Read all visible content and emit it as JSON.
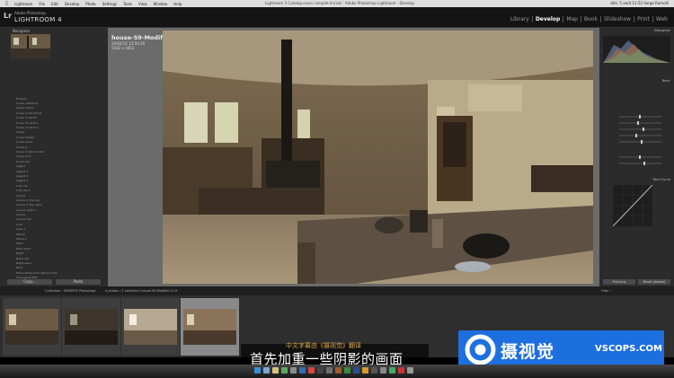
{
  "menubar": {
    "items": [
      "Lightroom",
      "File",
      "Edit",
      "Develop",
      "Photo",
      "Settings",
      "Tools",
      "View",
      "Window",
      "Help"
    ],
    "window_title": "Lightroom 5 Catalog-cours complet-4-lrcat - Adobe Photoshop Lightroom - Develop",
    "clock": "dim. 5 août 11:52  Serge Ramelli"
  },
  "identity": {
    "logo": "Lr",
    "app_small": "Adobe Photoshop",
    "app_big": "LIGHTROOM 4",
    "modules": [
      "Library",
      "Develop",
      "Map",
      "Book",
      "Slideshow",
      "Print",
      "Web"
    ],
    "active_module": "Develop"
  },
  "left_panel": {
    "navigator_title": "Navigator",
    "folders": [
      {
        "name": "Holland",
        "count": ""
      },
      {
        "name": "house cathedral",
        "count": ""
      },
      {
        "name": "house hollow",
        "count": ""
      },
      {
        "name": "house in the forest",
        "count": ""
      },
      {
        "name": "house of spirits",
        "count": ""
      },
      {
        "name": "house of cards 1",
        "count": ""
      },
      {
        "name": "house of cards 2",
        "count": ""
      },
      {
        "name": "house",
        "count": ""
      },
      {
        "name": "house hidden",
        "count": ""
      },
      {
        "name": "house piano",
        "count": ""
      },
      {
        "name": "house A",
        "count": ""
      },
      {
        "name": "house of spirit under",
        "count": ""
      },
      {
        "name": "house mini",
        "count": ""
      },
      {
        "name": "house sad",
        "count": ""
      },
      {
        "name": "Lagard",
        "count": ""
      },
      {
        "name": "Lagard 1",
        "count": ""
      },
      {
        "name": "Lagard 2",
        "count": ""
      },
      {
        "name": "Lagard 3",
        "count": ""
      },
      {
        "name": "Lost city",
        "count": ""
      },
      {
        "name": "Lost city 2",
        "count": ""
      },
      {
        "name": "Louvre",
        "count": ""
      },
      {
        "name": "Louvre in the day",
        "count": ""
      },
      {
        "name": "Louvre in the night",
        "count": ""
      },
      {
        "name": "Louvre night 2",
        "count": ""
      },
      {
        "name": "Louvre",
        "count": ""
      },
      {
        "name": "Louvre mix",
        "count": ""
      },
      {
        "name": "Lune",
        "count": ""
      },
      {
        "name": "Lune 2",
        "count": ""
      },
      {
        "name": "Marais",
        "count": ""
      },
      {
        "name": "Monaco",
        "count": ""
      },
      {
        "name": "Mont",
        "count": ""
      },
      {
        "name": "Mont Saint",
        "count": ""
      },
      {
        "name": "Night",
        "count": ""
      },
      {
        "name": "Night city",
        "count": ""
      },
      {
        "name": "Night seine",
        "count": ""
      },
      {
        "name": "Paris",
        "count": ""
      },
      {
        "name": "Photo Made and Lightroom Ed.",
        "count": ""
      },
      {
        "name": "Processing HDR",
        "count": ""
      },
      {
        "name": "Presets",
        "count": ""
      },
      {
        "name": "1 Image transform",
        "count": ""
      },
      {
        "name": "2 Black and White",
        "count": ""
      },
      {
        "name": "Lightroom Presets",
        "count": ""
      }
    ],
    "copy_label": "Copy...",
    "paste_label": "Paste"
  },
  "photo": {
    "filename": "house-59-Modifier-2.tif",
    "date": "19/04/12 13:50:20",
    "dimensions": "5182 x 3453"
  },
  "right_panel": {
    "histogram_title": "Histogram",
    "basic_title": "Basic",
    "tone_curve_title": "Tone Curve",
    "previous_label": "Previous",
    "reset_label": "Reset (Adobe)"
  },
  "filmstrip": {
    "crumb": "Collection : EXEMPLE Photoshop",
    "crumb2": "4 photos / 1 selected / house-59-Modifier-2.tif",
    "filter": "Filter :"
  },
  "subtitle": {
    "credit": "中文字幕由《摄视觉》翻译",
    "main": "首先加重一些阴影的画面"
  },
  "brand": {
    "cn": "摄视觉",
    "url": "VSCOPS.COM"
  },
  "colors": {
    "brand_blue": "#1d6fe0",
    "credit_gold": "#d9a847"
  }
}
